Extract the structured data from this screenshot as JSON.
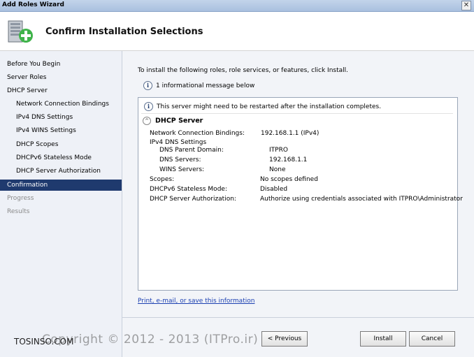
{
  "window": {
    "title": "Add Roles Wizard",
    "close_glyph": "✕"
  },
  "header": {
    "heading": "Confirm Installation Selections",
    "icon": "server-add-icon"
  },
  "sidebar": {
    "items": [
      {
        "label": "Before You Begin",
        "state": "normal",
        "level": 0
      },
      {
        "label": "Server Roles",
        "state": "normal",
        "level": 0
      },
      {
        "label": "DHCP Server",
        "state": "normal",
        "level": 0
      },
      {
        "label": "Network Connection Bindings",
        "state": "normal",
        "level": 1
      },
      {
        "label": "IPv4 DNS Settings",
        "state": "normal",
        "level": 1
      },
      {
        "label": "IPv4 WINS Settings",
        "state": "normal",
        "level": 1
      },
      {
        "label": "DHCP Scopes",
        "state": "normal",
        "level": 1
      },
      {
        "label": "DHCPv6 Stateless Mode",
        "state": "normal",
        "level": 1
      },
      {
        "label": "DHCP Server Authorization",
        "state": "normal",
        "level": 1
      },
      {
        "label": "Confirmation",
        "state": "active",
        "level": 0
      },
      {
        "label": "Progress",
        "state": "disabled",
        "level": 0
      },
      {
        "label": "Results",
        "state": "disabled",
        "level": 0
      }
    ]
  },
  "main": {
    "intro": "To install the following roles, role services, or features, click Install.",
    "info_message": "1 informational message below",
    "info_glyph": "i",
    "panel": {
      "warning": "This server might need to be restarted after the installation completes.",
      "section_title": "DHCP Server",
      "collapse_glyph": "^",
      "rows": [
        {
          "label": "Network Connection Bindings:",
          "value": "192.168.1.1 (IPv4)"
        },
        {
          "label": "IPv4 DNS Settings",
          "value": ""
        },
        {
          "label": "DNS Parent Domain:",
          "value": "ITPRO"
        },
        {
          "label": "DNS Servers:",
          "value": "192.168.1.1"
        },
        {
          "label": "WINS Servers:",
          "value": "None"
        },
        {
          "label": "Scopes:",
          "value": "No scopes defined"
        },
        {
          "label": "DHCPv6 Stateless Mode:",
          "value": "Disabled"
        },
        {
          "label": "DHCP Server Authorization:",
          "value": "Authorize using credentials associated with ITPRO\\Administrator"
        }
      ]
    },
    "link": "Print, e-mail, or save this information"
  },
  "footer": {
    "buttons": [
      {
        "label": "< Previous"
      },
      {
        "label": "Install"
      },
      {
        "label": "Cancel"
      }
    ],
    "watermark": "Copyright © 2012 - 2013 (ITPro.ir)",
    "brand": "TOSINSO.COM"
  }
}
